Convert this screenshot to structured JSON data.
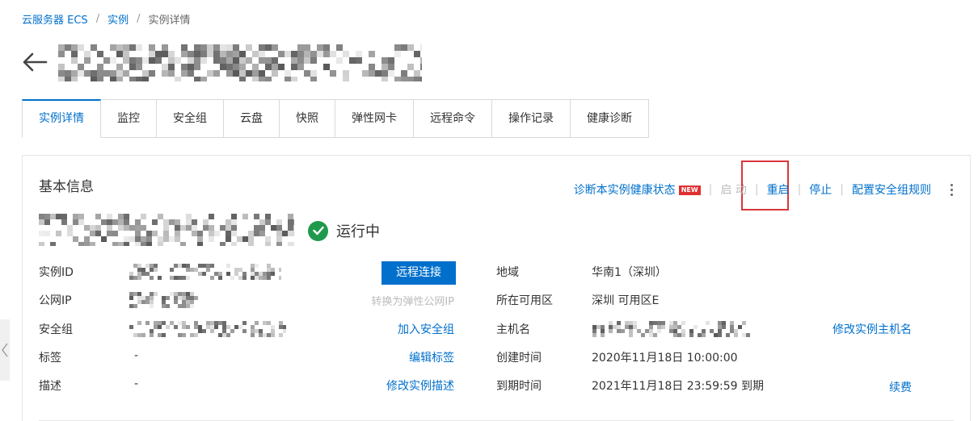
{
  "breadcrumb": {
    "root": "云服务器 ECS",
    "parent": "实例",
    "current": "实例详情",
    "separator": "/"
  },
  "tabs": [
    "实例详情",
    "监控",
    "安全组",
    "云盘",
    "快照",
    "弹性网卡",
    "远程命令",
    "操作记录",
    "健康诊断"
  ],
  "panel": {
    "title": "基本信息",
    "actions": {
      "diagnose": "诊断本实例健康状态",
      "new_badge": "NEW",
      "start": "启 动",
      "restart": "重启",
      "stop": "停止",
      "security_rules": "配置安全组规则"
    },
    "status": "运行中",
    "left_rows": {
      "instance_id_label": "实例ID",
      "public_ip_label": "公网IP",
      "security_group_label": "安全组",
      "tags_label": "标签",
      "tags_value": "-",
      "description_label": "描述",
      "description_value": "-"
    },
    "left_actions": {
      "remote_connect": "远程连接",
      "convert_eip": "转换为弹性公网IP",
      "join_security_group": "加入安全组",
      "edit_tags": "编辑标签",
      "edit_description": "修改实例描述"
    },
    "right_rows": {
      "region_label": "地域",
      "region_value": "华南1（深圳）",
      "zone_label": "所在可用区",
      "zone_value": "深圳 可用区E",
      "hostname_label": "主机名",
      "created_label": "创建时间",
      "created_value": "2020年11月18日 10:00:00",
      "expire_label": "到期时间",
      "expire_value": "2021年11月18日 23:59:59 到期"
    },
    "right_actions": {
      "edit_hostname": "修改实例主机名",
      "renew": "续费"
    }
  },
  "colors": {
    "accent": "#0070cc",
    "status_green": "#1f9a4c",
    "highlight_red": "#d9373b",
    "badge_red": "#e03131"
  },
  "icons": [
    "back-arrow-icon",
    "check-circle-icon",
    "more-icon",
    "chevron-left-icon"
  ]
}
